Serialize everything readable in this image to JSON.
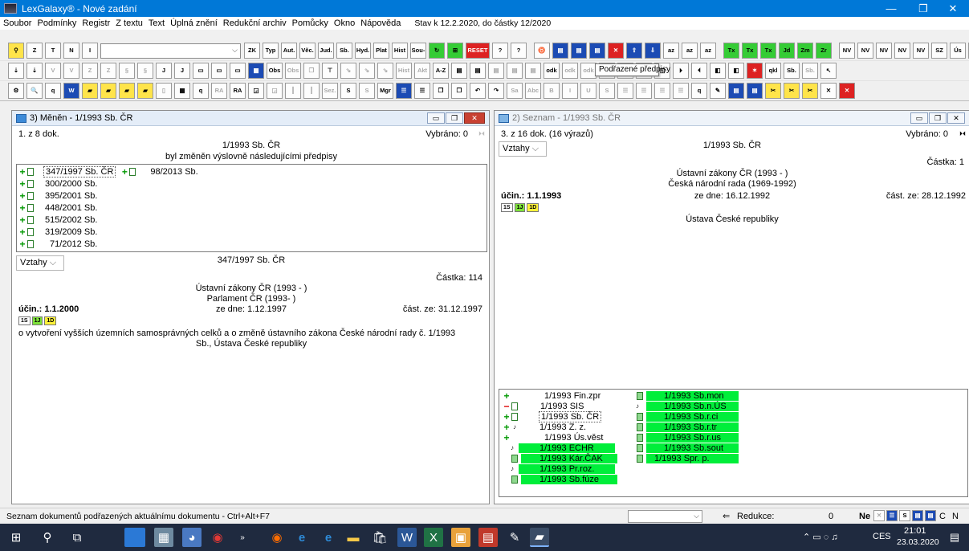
{
  "window": {
    "title": "LexGalaxy® - Nové zadání",
    "minimize": "—",
    "maximize": "❐",
    "close": "✕"
  },
  "menu": {
    "items": [
      "Soubor",
      "Podmínky",
      "Registr",
      "Z textu",
      "Text",
      "Úplná znění",
      "Redukční archiv",
      "Pomůcky",
      "Okno",
      "Nápověda"
    ],
    "status": "Stav k 12.2.2020, do částky 12/2020"
  },
  "toolbar1": {
    "search_value": "",
    "buttons": [
      "ZK",
      "Typ",
      "Aut.",
      "Věc.",
      "Jud.",
      "Sb.",
      "Hyd.",
      "Plat",
      "Hist",
      "Sou-"
    ],
    "reset": "RESET"
  },
  "toolbar2": {
    "buttons": [
      "Obs",
      "Obs",
      "Hist",
      "Akt",
      "A-Z",
      "odk",
      "odk",
      "odk",
      "Sb.",
      "Sb."
    ]
  },
  "toolbar3": {
    "buttons": [
      "Sez.",
      "Mgr",
      "Abc",
      "B",
      "I",
      "U",
      "S"
    ]
  },
  "tooltip": "Podřazené předpisy",
  "left_panel": {
    "title": "3) Měněn - 1/1993 Sb. ČR",
    "count": "1. z 8 dok.",
    "selected": "Vybráno: 0",
    "heading": "1/1993 Sb. ČR",
    "subheading": "byl změněn výslovně následujícími předpisy",
    "relations": [
      {
        "label": "347/1997 Sb. ČR",
        "extra": "98/2013 Sb."
      },
      {
        "label": "300/2000 Sb."
      },
      {
        "label": "395/2001 Sb."
      },
      {
        "label": "448/2001 Sb."
      },
      {
        "label": "515/2002 Sb."
      },
      {
        "label": "319/2009 Sb."
      },
      {
        "label": "71/2012 Sb."
      }
    ],
    "vztahy": "Vztahy",
    "detail": {
      "doc": "347/1997 Sb. ČR",
      "castka": "Částka: 114",
      "line1": "Ústavní zákony ČR (1993 -   )",
      "line2": "Parlament ČR (1993-   )",
      "ucin": "účin.: 1.1.2000",
      "ze_dne": "ze dne: 1.12.1997",
      "cast": "část. ze: 31.12.1997",
      "tags": [
        "1S",
        "1J",
        "1D"
      ],
      "description1": "o vytvoření vyšších územních samosprávných celků a o změně ústavního zákona České národní rady č. 1/1993",
      "description2": "Sb., Ústava České republiky"
    }
  },
  "right_panel": {
    "title": "2) Seznam - 1/1993 Sb. ČR",
    "count": "3. z 16 dok. (16 výrazů)",
    "selected": "Vybráno: 0",
    "vztahy": "Vztahy",
    "heading": "1/1993 Sb. ČR",
    "castka": "Částka: 1",
    "line1": "Ústavní zákony ČR (1993 -   )",
    "line2": "Česká národní rada (1969-1992)",
    "ucin": "účin.: 1.1.1993",
    "ze_dne": "ze dne: 16.12.1992",
    "cast": "část. ze: 28.12.1992",
    "tags": [
      "1S",
      "1J",
      "1D"
    ],
    "doc_title": "Ústava České republiky",
    "list_left": [
      "1/1993 Fin.zpr",
      "1/1993 SIS",
      "1/1993 Sb. ČR",
      "1/1993 Z. z.",
      "1/1993 Ús.věst",
      "1/1993 ECHR",
      "1/1993 Kár.ČAK",
      "1/1993 Pr.roz.",
      "1/1993 Sb.fúze"
    ],
    "list_right": [
      "1/1993 Sb.mon",
      "1/1993 Sb.n.ÚS",
      "1/1993 Sb.r.ci",
      "1/1993 Sb.r.tr",
      "1/1993 Sb.r.us",
      "1/1993 Sb.sout",
      "1/1993 Spr. p."
    ]
  },
  "statusbar": {
    "text": "Seznam dokumentů podřazených aktuálnímu dokumentu - Ctrl+Alt+F7",
    "reduction_label": "Redukce:",
    "reduction_value": "0",
    "ne": "Ne",
    "c": "C",
    "n": "N"
  },
  "taskbar": {
    "language": "CES",
    "time": "21:01",
    "date": "23.03.2020"
  }
}
